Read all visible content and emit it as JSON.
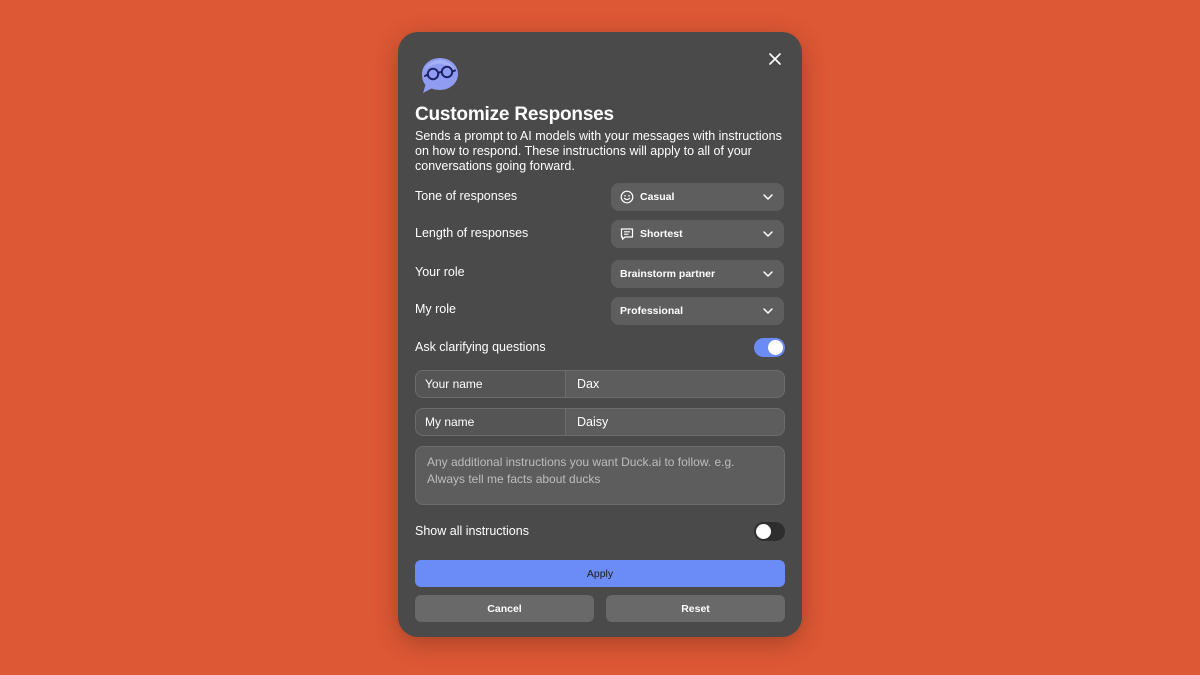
{
  "dialog": {
    "title": "Customize Responses",
    "description": "Sends a prompt to AI models with your messages with instructions on how to respond. These instructions will apply to all of your conversations going forward.",
    "logo_icon": "glasses-chat-bubble-icon",
    "close_icon": "close-icon"
  },
  "settings": {
    "tone": {
      "label": "Tone of responses",
      "value": "Casual",
      "icon": "smiley-icon"
    },
    "length": {
      "label": "Length of responses",
      "value": "Shortest",
      "icon": "message-lines-icon"
    },
    "your_role": {
      "label": "Your role",
      "value": "Brainstorm partner"
    },
    "my_role": {
      "label": "My role",
      "value": "Professional"
    },
    "clarifying": {
      "label": "Ask clarifying questions",
      "enabled": true
    }
  },
  "names": {
    "your_name": {
      "label": "Your name",
      "value": "Dax"
    },
    "my_name": {
      "label": "My name",
      "value": "Daisy"
    }
  },
  "instructions": {
    "placeholder": "Any additional instructions you want Duck.ai to follow. e.g. Always tell me facts about ducks"
  },
  "show_all": {
    "label": "Show all instructions",
    "enabled": false
  },
  "buttons": {
    "apply": "Apply",
    "cancel": "Cancel",
    "reset": "Reset"
  },
  "colors": {
    "background": "#dd5834",
    "modal": "#4a4a4a",
    "accent": "#6b8cf5"
  }
}
